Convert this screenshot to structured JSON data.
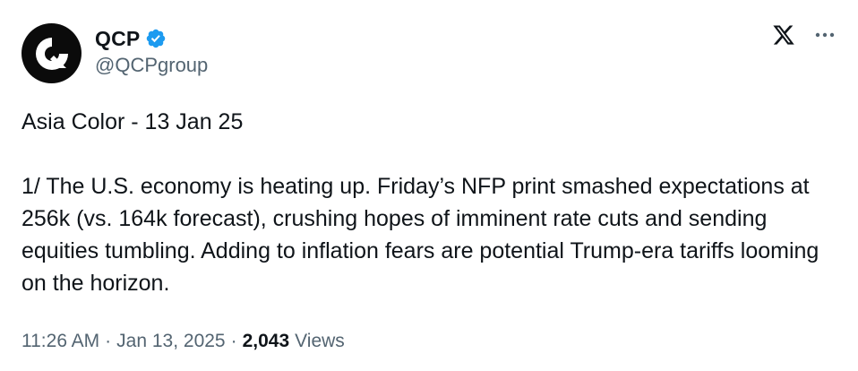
{
  "author": {
    "display_name": "QCP",
    "handle": "@QCPgroup",
    "verified": true,
    "avatar_icon": "qcp-logo-icon"
  },
  "tweet": {
    "title_line": "Asia Color - 13 Jan 25",
    "body_line": "1/ The U.S. economy is heating up. Friday’s NFP print smashed expectations at 256k (vs. 164k forecast), crushing hopes of imminent rate cuts and sending equities tumbling. Adding to inflation fears are potential Trump-era tariffs looming on the horizon."
  },
  "meta": {
    "time": "11:26 AM",
    "sep1": "·",
    "date": "Jan 13, 2025",
    "sep2": "·",
    "views_count": "2,043",
    "views_label": "Views"
  },
  "icons": {
    "platform": "x-logo-icon",
    "more": "more-options-icon",
    "verified": "verified-badge-icon"
  },
  "colors": {
    "text_primary": "#0f1419",
    "text_secondary": "#536471",
    "verified_blue": "#1d9bf0",
    "avatar_bg": "#0b0b0b"
  }
}
